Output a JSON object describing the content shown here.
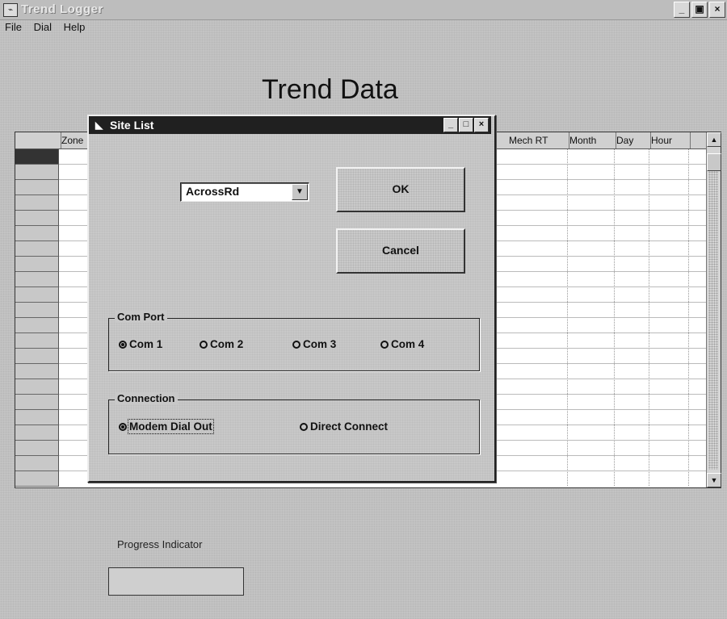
{
  "window": {
    "title": "Trend Logger",
    "icon": "app-icon"
  },
  "menu": {
    "items": [
      "File",
      "Dial",
      "Help"
    ]
  },
  "main": {
    "heading": "Trend Data"
  },
  "grid": {
    "columns": [
      "Zone",
      "Mech RT",
      "Month",
      "Day",
      "Hour"
    ]
  },
  "progress": {
    "label": "Progress Indicator",
    "fraction": 0.0
  },
  "dialog": {
    "title": "Site List",
    "site_value": "AcrossRd",
    "ok_label": "OK",
    "cancel_label": "Cancel",
    "comport": {
      "legend": "Com Port",
      "options": [
        "Com 1",
        "Com 2",
        "Com 3",
        "Com 4"
      ],
      "selected": "Com 1"
    },
    "connection": {
      "legend": "Connection",
      "options": [
        "Modem Dial Out",
        "Direct Connect"
      ],
      "selected": "Modem Dial Out"
    }
  },
  "colors": {
    "dialog_titlebar": "#202020",
    "window_bg": "#c3c3c3"
  }
}
